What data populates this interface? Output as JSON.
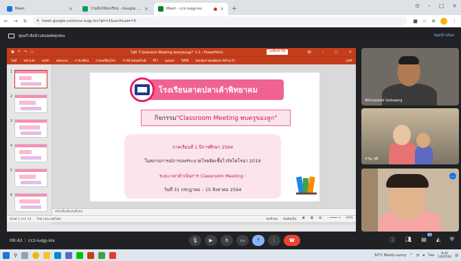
{
  "browser": {
    "tabs": [
      {
        "label": "Meet",
        "favicon_color": "#1a73e8"
      },
      {
        "label": "รวมลิงก์ห้องเรียน - Google Sheet",
        "favicon_color": "#0f9d58"
      },
      {
        "label": "Meet - ccz-iuqg-iov",
        "favicon_color": "#00832d"
      }
    ],
    "url": "meet.google.com/ccz-iuqg-iov?pli=1&authuser=0"
  },
  "meet": {
    "presenting_text": "คุณกำลังนำเสนอต่อทุกคน",
    "stop_presenting": "หยุดนำเสนอ",
    "meeting_time": "09:42",
    "meeting_code": "ccz-iuqg-iov",
    "participants": [
      {
        "name": "Wichaichok Sodsaeng"
      },
      {
        "name": "ขวัญ วุฒิ"
      },
      {
        "name": ""
      }
    ],
    "participant_count": "4"
  },
  "ppt": {
    "title": "ไฟล์ \"Classroom Meeting พบครูของลูก\" 1-1 - PowerPoint",
    "signin": "ลงชื่อเข้าใช้",
    "ribbon_tabs": [
      "ไฟล์",
      "หน้าแรก",
      "แทรก",
      "ออกแบบ",
      "การเปลี่ยน",
      "ภาพเคลื่อนไหว",
      "การนำเสนอสไลด์",
      "รีวิว",
      "มุมมอง",
      "วิธีใช้",
      "บอกฉันว่าคุณต้องการทำอะไร"
    ],
    "share": "แชร์",
    "thumb_numbers": [
      "1",
      "2",
      "3",
      "4",
      "5",
      "6"
    ],
    "notes_hint": "คลิกเพื่อเพิ่มบันทึกย่อ",
    "status_left": "สไลด์ 1 จาก 13",
    "status_lang": "ไทย (ประเทศไทย)",
    "status_notes": "บันทึกย่อ",
    "status_comments": "ข้อคิดเห็น",
    "zoom": "60%"
  },
  "slide": {
    "school_name": "โรงเรียนลาดปลาเค้าพิทยาคม",
    "activity_prefix": "กิจกรรม ",
    "activity_highlight": "\"Classroom Meeting พบครูของลูก\"",
    "line1": "ภาคเรียนที่ 1 ปีการศึกษา 2564",
    "line2": "ในสถานการณ์การแพร่ระบาดโรคติดเชื้อไวรัสโคโรนา 2019",
    "line3": "ระยะเวลาดำเนินการ Classroom Meeting :",
    "line4": "วันที่ 31 กรกฎาคม – 15 สิงหาคม 2564"
  },
  "taskbar": {
    "weather": "32°C Mostly sunny",
    "time": "9:42",
    "date": "1/8/2564",
    "lang": "ไทย"
  },
  "colors": {
    "ppt_red": "#c43e1c",
    "slide_pink": "#f06292",
    "meet_bg": "#202124",
    "end_call": "#ea4335"
  }
}
